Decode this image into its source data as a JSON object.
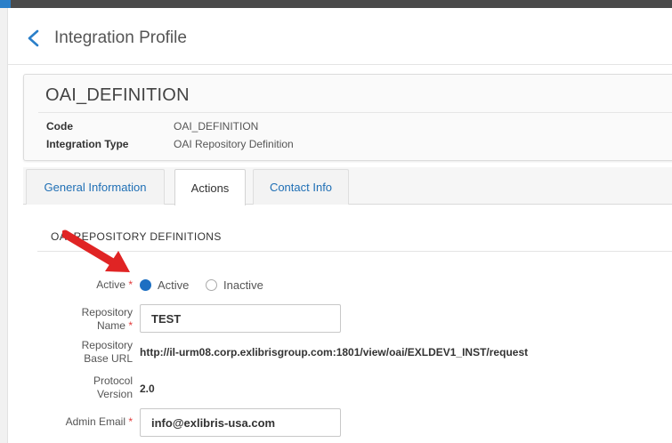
{
  "header": {
    "title": "Integration Profile"
  },
  "profile": {
    "name": "OAI_DEFINITION",
    "fields": [
      {
        "label": "Code",
        "value": "OAI_DEFINITION"
      },
      {
        "label": "Integration Type",
        "value": "OAI Repository Definition"
      }
    ]
  },
  "tabs": [
    {
      "label": "General Information",
      "active": false
    },
    {
      "label": "Actions",
      "active": true
    },
    {
      "label": "Contact Info",
      "active": false
    }
  ],
  "section": {
    "title": "OAI REPOSITORY DEFINITIONS"
  },
  "form": {
    "active": {
      "label": "Active",
      "required_mark": "*",
      "options": [
        {
          "label": "Active",
          "selected": true
        },
        {
          "label": "Inactive",
          "selected": false
        }
      ]
    },
    "repository_name": {
      "label_line1": "Repository",
      "label_line2": "Name",
      "required_mark": "*",
      "value": "TEST"
    },
    "repository_base_url": {
      "label_line1": "Repository",
      "label_line2": "Base URL",
      "value": "http://il-urm08.corp.exlibrisgroup.com:1801/view/oai/EXLDEV1_INST/request"
    },
    "protocol_version": {
      "label_line1": "Protocol",
      "label_line2": "Version",
      "value": "2.0"
    },
    "admin_email": {
      "label": "Admin Email",
      "required_mark": "*",
      "value": "info@exlibris-usa.com"
    }
  },
  "colors": {
    "accent": "#1d6fc2",
    "required": "#e23b3b",
    "annotation_arrow": "#e02424",
    "top_bar": "#4a4a4a"
  },
  "icons": {
    "back": "chevron-left-icon",
    "annotation": "red-arrow-annotation"
  }
}
